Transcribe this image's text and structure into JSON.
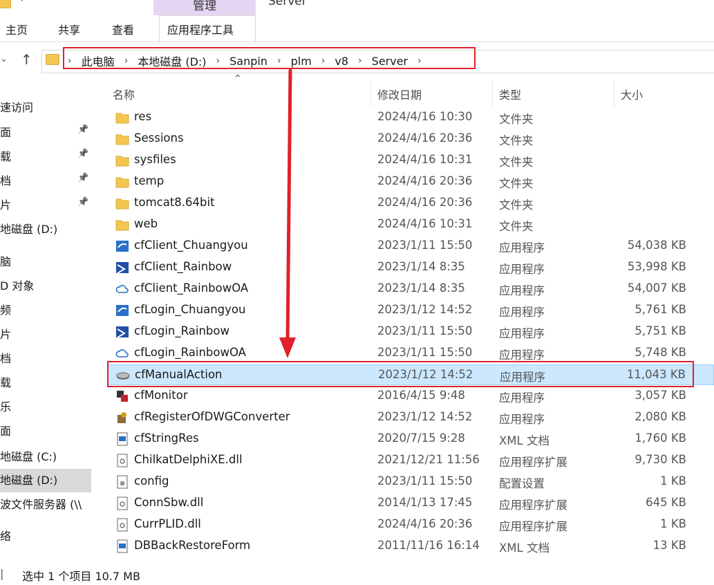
{
  "window": {
    "manage_label": "管理",
    "folder_title": "Server"
  },
  "ribbon": {
    "tabs": [
      "主页",
      "共享",
      "查看",
      "应用程序工具"
    ]
  },
  "address_bar": {
    "crumbs": [
      "此电脑",
      "本地磁盘 (D:)",
      "Sanpin",
      "plm",
      "v8",
      "Server"
    ]
  },
  "sidebar": {
    "items": [
      {
        "label": "速访问",
        "pinned": false
      },
      {
        "label": "面",
        "pinned": true
      },
      {
        "label": "载",
        "pinned": true
      },
      {
        "label": "档",
        "pinned": true
      },
      {
        "label": "片",
        "pinned": true
      },
      {
        "label": "地磁盘 (D:)",
        "pinned": false
      },
      {
        "label": "脑",
        "pinned": false
      },
      {
        "label": "D 对象",
        "pinned": false
      },
      {
        "label": "频",
        "pinned": false
      },
      {
        "label": "片",
        "pinned": false
      },
      {
        "label": "档",
        "pinned": false
      },
      {
        "label": "载",
        "pinned": false
      },
      {
        "label": "乐",
        "pinned": false
      },
      {
        "label": "面",
        "pinned": false
      },
      {
        "label": "地磁盘 (C:)",
        "pinned": false
      },
      {
        "label": "地磁盘 (D:)",
        "pinned": false,
        "selected": true
      },
      {
        "label": "波文件服务器 (\\\\",
        "pinned": false
      },
      {
        "label": "络",
        "pinned": false
      }
    ]
  },
  "columns": {
    "name": "名称",
    "date": "修改日期",
    "type": "类型",
    "size": "大小"
  },
  "files": [
    {
      "name": "res",
      "date": "2024/4/16 10:30",
      "type": "文件夹",
      "size": "",
      "icon": "folder-icon"
    },
    {
      "name": "Sessions",
      "date": "2024/4/16 20:36",
      "type": "文件夹",
      "size": "",
      "icon": "folder-icon"
    },
    {
      "name": "sysfiles",
      "date": "2024/4/16 10:31",
      "type": "文件夹",
      "size": "",
      "icon": "folder-icon"
    },
    {
      "name": "temp",
      "date": "2024/4/16 20:36",
      "type": "文件夹",
      "size": "",
      "icon": "folder-icon"
    },
    {
      "name": "tomcat8.64bit",
      "date": "2024/4/16 20:36",
      "type": "文件夹",
      "size": "",
      "icon": "folder-icon"
    },
    {
      "name": "web",
      "date": "2024/4/16 10:31",
      "type": "文件夹",
      "size": "",
      "icon": "folder-icon"
    },
    {
      "name": "cfClient_Chuangyou",
      "date": "2023/1/11 15:50",
      "type": "应用程序",
      "size": "54,038 KB",
      "icon": "app-blue-icon"
    },
    {
      "name": "cfClient_Rainbow",
      "date": "2023/1/14 8:35",
      "type": "应用程序",
      "size": "53,998 KB",
      "icon": "app-rainbow-icon"
    },
    {
      "name": "cfClient_RainbowOA",
      "date": "2023/1/14 8:35",
      "type": "应用程序",
      "size": "54,007 KB",
      "icon": "app-cloud-icon"
    },
    {
      "name": "cfLogin_Chuangyou",
      "date": "2023/1/12 14:52",
      "type": "应用程序",
      "size": "5,761 KB",
      "icon": "app-blue-icon"
    },
    {
      "name": "cfLogin_Rainbow",
      "date": "2023/1/11 15:50",
      "type": "应用程序",
      "size": "5,751 KB",
      "icon": "app-rainbow-icon"
    },
    {
      "name": "cfLogin_RainbowOA",
      "date": "2023/1/11 15:50",
      "type": "应用程序",
      "size": "5,748 KB",
      "icon": "app-cloud-icon"
    },
    {
      "name": "cfManualAction",
      "date": "2023/1/12 14:52",
      "type": "应用程序",
      "size": "11,043 KB",
      "icon": "app-drive-icon",
      "selected": true
    },
    {
      "name": "cfMonitor",
      "date": "2016/4/15 9:48",
      "type": "应用程序",
      "size": "3,057 KB",
      "icon": "app-monitor-icon"
    },
    {
      "name": "cfRegisterOfDWGConverter",
      "date": "2023/1/12 14:52",
      "type": "应用程序",
      "size": "2,080 KB",
      "icon": "app-setup-icon"
    },
    {
      "name": "cfStringRes",
      "date": "2020/7/15 9:28",
      "type": "XML 文档",
      "size": "1,760 KB",
      "icon": "xml-doc-icon"
    },
    {
      "name": "ChilkatDelphiXE.dll",
      "date": "2021/12/21 11:56",
      "type": "应用程序扩展",
      "size": "9,730 KB",
      "icon": "dll-icon"
    },
    {
      "name": "config",
      "date": "2023/1/11 15:50",
      "type": "配置设置",
      "size": "1 KB",
      "icon": "config-icon"
    },
    {
      "name": "ConnSbw.dll",
      "date": "2014/1/13 17:45",
      "type": "应用程序扩展",
      "size": "645 KB",
      "icon": "dll-icon"
    },
    {
      "name": "CurrPLID.dll",
      "date": "2024/4/16 20:36",
      "type": "应用程序扩展",
      "size": "1 KB",
      "icon": "dll-icon"
    },
    {
      "name": "DBBackRestoreForm",
      "date": "2011/11/16 16:14",
      "type": "XML 文档",
      "size": "13 KB",
      "icon": "xml-doc-icon"
    }
  ],
  "status_bar": {
    "selection": "选中 1 个项目  10.7 MB"
  },
  "colors": {
    "annotation_red": "#e0202a",
    "selection_bg": "#cce8ff",
    "manage_band": "#e5d5f3",
    "folder_yellow": "#f3c74f"
  }
}
